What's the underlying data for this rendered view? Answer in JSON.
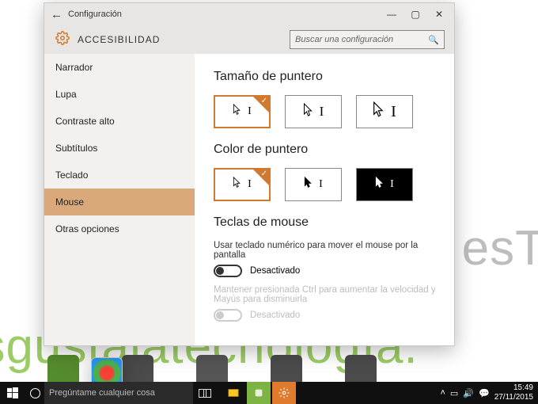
{
  "window": {
    "title": "Configuración",
    "category": "ACCESIBILIDAD",
    "search_placeholder": "Buscar una configuración"
  },
  "sidebar": {
    "items": [
      {
        "label": "Narrador"
      },
      {
        "label": "Lupa"
      },
      {
        "label": "Contraste alto"
      },
      {
        "label": "Subtítulos"
      },
      {
        "label": "Teclado"
      },
      {
        "label": "Mouse",
        "selected": true
      },
      {
        "label": "Otras opciones"
      }
    ]
  },
  "content": {
    "pointer_size_heading": "Tamaño de puntero",
    "pointer_color_heading": "Color de puntero",
    "mouse_keys_heading": "Teclas de mouse",
    "mouse_keys_desc": "Usar teclado numérico para mover el mouse por la pantalla",
    "mouse_keys_state": "Desactivado",
    "ctrl_desc": "Mantener presionada Ctrl para aumentar la velocidad y Mayús para disminuirla",
    "ctrl_state": "Desactivado"
  },
  "taskbar": {
    "search_placeholder": "Pregúntame cualquier cosa",
    "time": "15:49",
    "date": "27/11/2015"
  },
  "colors": {
    "accent": "#d17a2f"
  }
}
